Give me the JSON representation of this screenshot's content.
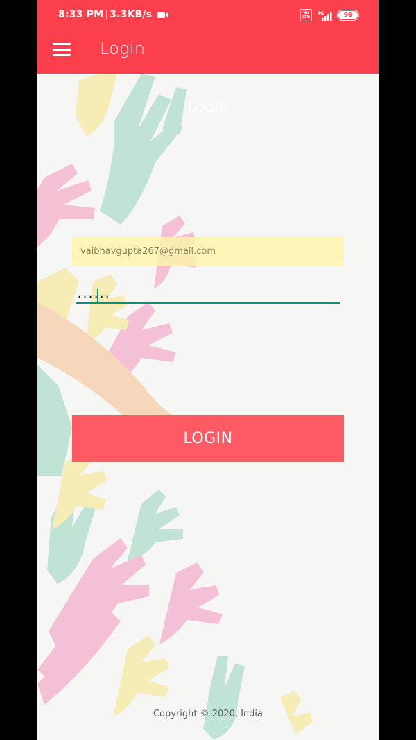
{
  "status_bar": {
    "time": "8:33 PM",
    "network_speed": "3.3KB/s",
    "volte": "Vo LTE",
    "signal_label": "4G",
    "battery": "96"
  },
  "app_bar": {
    "menu_icon": "hamburger-menu-icon",
    "title": "Login"
  },
  "form": {
    "heading": "Login",
    "email_value": "vaibhavgupta267@gmail.com",
    "password_value": "......",
    "login_button": "LOGIN"
  },
  "footer": {
    "copyright": "Copyright © 2020, India"
  },
  "colors": {
    "accent": "#fc3f4c",
    "button": "#fd5a63",
    "underline_focus": "#0c8f77"
  }
}
